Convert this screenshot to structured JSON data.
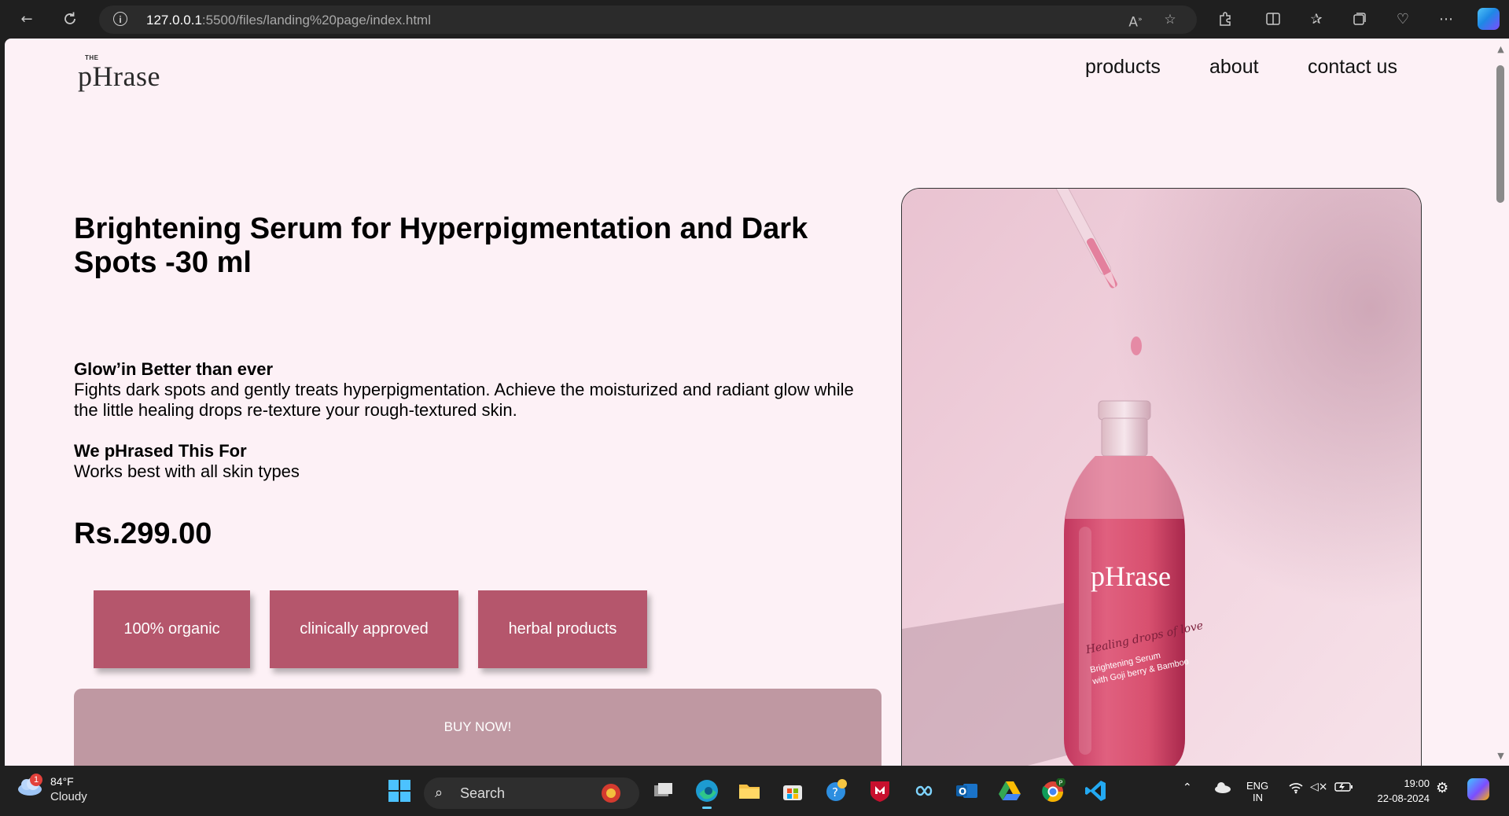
{
  "browser": {
    "url_host": "127.0.0.1",
    "url_path": ":5500/files/landing%20page/index.html"
  },
  "page": {
    "logo": {
      "small": "THE",
      "word": "pHrase"
    },
    "nav": [
      "products",
      "about",
      "contact us"
    ],
    "headline": "Brightening Serum for Hyperpigmentation and Dark Spots -30 ml",
    "tagline_title": "Glow’in Better than ever",
    "tagline_text": "Fights dark spots and gently treats hyperpigmentation. Achieve the moisturized and radiant glow while the little healing drops re-texture your rough-textured skin.",
    "for_title": "We pHrased This For",
    "for_text": "Works best with all skin types",
    "price": "Rs.299.00",
    "badges": [
      "100% organic",
      "clinically approved",
      "herbal products"
    ],
    "buy_label": "BUY NOW!",
    "bottle_brand": "pHrase",
    "bottle_script": "Healing drops of love",
    "bottle_line1": "Brightening Serum",
    "bottle_line2": "with Goji berry & Bamboo"
  },
  "taskbar": {
    "weather_temp": "84°F",
    "weather_cond": "Cloudy",
    "weather_count": "1",
    "search_label": "Search",
    "lang1": "ENG",
    "lang2": "IN",
    "time": "19:00",
    "date": "22-08-2024"
  },
  "colors": {
    "page_bg": "#fdf1f6",
    "badge_bg": "#b5566c",
    "buy_bg": "#bf98a2"
  }
}
